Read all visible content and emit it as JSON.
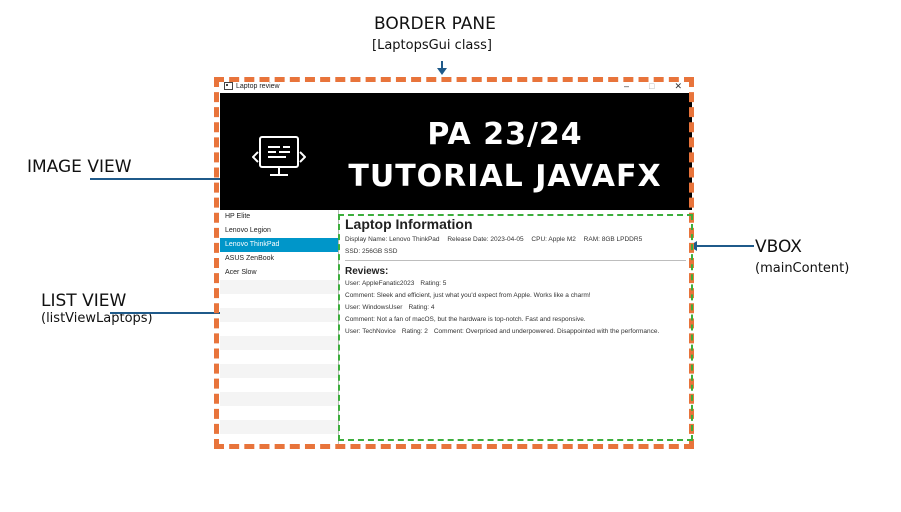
{
  "annotations": {
    "border_pane": {
      "title": "BORDER PANE",
      "subtitle": "[LaptopsGui class]"
    },
    "image_view": {
      "title": "IMAGE VIEW"
    },
    "list_view": {
      "title": "LIST VIEW",
      "subtitle": "(listViewLaptops)"
    },
    "vbox": {
      "title": "VBOX",
      "subtitle": "(mainContent)"
    }
  },
  "window": {
    "title": "Laptop review",
    "controls": {
      "minimize": "–",
      "maximize": "□",
      "close": "✕"
    }
  },
  "banner": {
    "line1": "PA 23/24",
    "line2": "TUTORIAL JAVAFX",
    "icon": "monitor-code-icon"
  },
  "laptops": [
    "HP Elite",
    "Lenovo Legion",
    "Lenovo ThinkPad",
    "ASUS ZenBook",
    "Acer Slow"
  ],
  "selected_index": 2,
  "info": {
    "heading": "Laptop Information",
    "display_name": "Display Name: Lenovo ThinkPad",
    "release_date": "Release Date: 2023-04-05",
    "cpu": "CPU: Apple M2",
    "ram": "RAM: 8GB LPDDR5",
    "ssd": "SSD: 256GB SSD"
  },
  "reviews_heading": "Reviews:",
  "reviews": [
    {
      "user": "User: AppleFanatic2023",
      "rating": "Rating: 5",
      "comment": "Comment: Sleek and efficient, just what you'd expect from Apple. Works like a charm!"
    },
    {
      "user": "User: WindowsUser",
      "rating": "Rating: 4",
      "comment": "Comment: Not a fan of macOS, but the hardware is top-notch. Fast and responsive."
    },
    {
      "user": "User: TechNovice",
      "rating": "Rating: 2",
      "comment": "Comment: Overpriced and underpowered. Disappointed with the performance."
    }
  ],
  "colors": {
    "border_pane_outline": "#e8743b",
    "vbox_outline": "#3cae3c",
    "selection": "#0096c9",
    "arrow": "#1f5a8a"
  }
}
